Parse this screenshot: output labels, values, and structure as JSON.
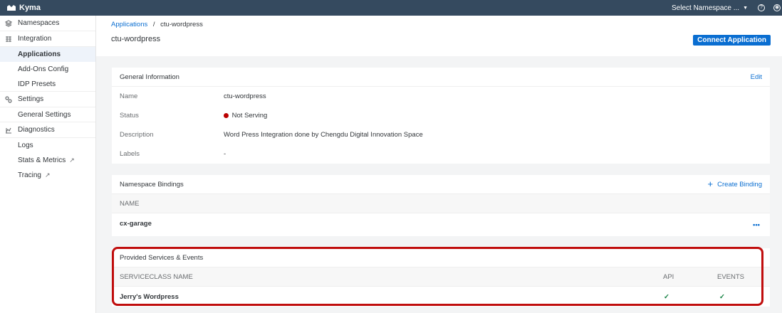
{
  "topbar": {
    "brand": "Kyma",
    "namespace_select": "Select Namespace ...",
    "help_icon": "?",
    "user_icon": "user-icon"
  },
  "sidebar": {
    "categories": [
      {
        "label": "Namespaces",
        "icon": "namespaces-icon"
      },
      {
        "label": "Integration",
        "icon": "integration-icon"
      },
      {
        "label": "Settings",
        "icon": "settings-icon"
      },
      {
        "label": "Diagnostics",
        "icon": "diagnostics-icon"
      }
    ],
    "items": [
      {
        "label": "Applications"
      },
      {
        "label": "Add-Ons Config"
      },
      {
        "label": "IDP Presets"
      },
      {
        "label": "General Settings"
      },
      {
        "label": "Logs"
      },
      {
        "label": "Stats & Metrics"
      },
      {
        "label": "Tracing"
      }
    ]
  },
  "header": {
    "breadcrumb_root": "Applications",
    "breadcrumb_sep": "/",
    "breadcrumb_current": "ctu-wordpress",
    "title": "ctu-wordpress",
    "connect_label": "Connect Application"
  },
  "general": {
    "title": "General Information",
    "edit_label": "Edit",
    "rows": [
      {
        "key": "Name",
        "value": "ctu-wordpress"
      },
      {
        "key": "Status",
        "value": "Not Serving"
      },
      {
        "key": "Description",
        "value": "Word Press Integration done by Chengdu Digital Innovation Space"
      },
      {
        "key": "Labels",
        "value": "-"
      }
    ]
  },
  "bindings": {
    "title": "Namespace Bindings",
    "create_label": "Create Binding",
    "col_name": "NAME",
    "rows": [
      {
        "name": "cx-garage",
        "more": "•••"
      }
    ]
  },
  "services": {
    "title": "Provided Services & Events",
    "col_name": "SERVICECLASS NAME",
    "col_api": "API",
    "col_events": "EVENTS",
    "rows": [
      {
        "name": "Jerry's Wordpress",
        "api": "✓",
        "events": "✓"
      }
    ]
  },
  "colors": {
    "topbar": "#354a5f",
    "accent": "#0a6ed1",
    "error": "#bb0000",
    "success": "#107e3e",
    "highlight": "#c00d0d"
  }
}
